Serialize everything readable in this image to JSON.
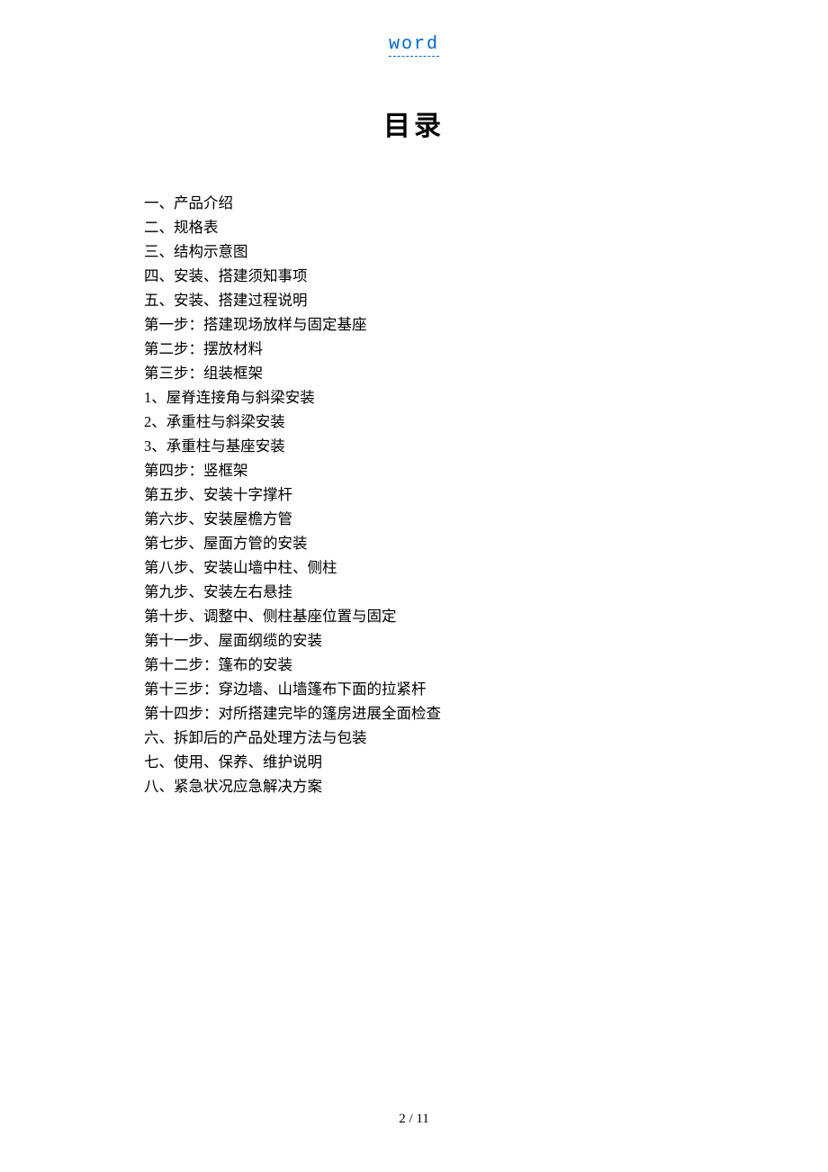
{
  "header": {
    "link_text": "word"
  },
  "title": "目录",
  "toc": {
    "items": [
      "一、产品介绍",
      "二、规格表",
      "三、结构示意图",
      "四、安装、搭建须知事项",
      "五、安装、搭建过程说明",
      "第一步：搭建现场放样与固定基座",
      "第二步：摆放材料",
      "第三步：组装框架",
      "1、屋脊连接角与斜梁安装",
      "2、承重柱与斜梁安装",
      "3、承重柱与基座安装",
      "第四步：竖框架",
      "第五步、安装十字撑杆",
      "第六步、安装屋檐方管",
      "第七步、屋面方管的安装",
      "第八步、安装山墙中柱、侧柱",
      "第九步、安装左右悬挂",
      "第十步、调整中、侧柱基座位置与固定",
      "第十一步、屋面纲缆的安装",
      "第十二步：篷布的安装",
      "第十三步：穿边墙、山墙篷布下面的拉紧杆",
      "第十四步：对所搭建完毕的篷房进展全面检查",
      "六、拆卸后的产品处理方法与包装",
      "七、使用、保养、维护说明",
      "八、紧急状况应急解决方案"
    ]
  },
  "footer": {
    "page_number": "2 / 11"
  }
}
